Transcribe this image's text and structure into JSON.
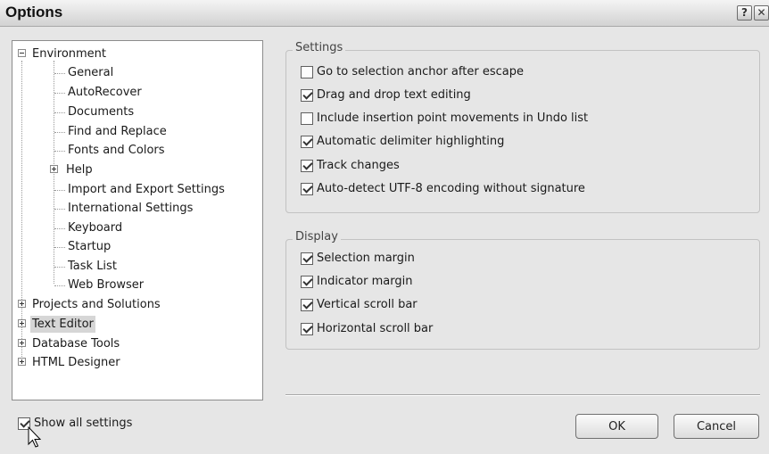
{
  "window": {
    "title": "Options",
    "help_glyph": "?",
    "close_glyph": "✕"
  },
  "tree": {
    "environment": "Environment",
    "env_children": [
      "General",
      "AutoRecover",
      "Documents",
      "Find and Replace",
      "Fonts and Colors",
      "Help",
      "Import and Export Settings",
      "International Settings",
      "Keyboard",
      "Startup",
      "Task List",
      "Web Browser"
    ],
    "projects": "Projects and Solutions",
    "text_editor": "Text Editor",
    "database_tools": "Database Tools",
    "html_designer": "HTML Designer",
    "selected": "Text Editor"
  },
  "settings_group": {
    "title": "Settings",
    "items": [
      {
        "label": "Go to selection anchor after escape",
        "checked": false
      },
      {
        "label": "Drag and drop text editing",
        "checked": true
      },
      {
        "label": "Include insertion point movements in Undo list",
        "checked": false
      },
      {
        "label": "Automatic delimiter highlighting",
        "checked": true
      },
      {
        "label": "Track changes",
        "checked": true
      },
      {
        "label": "Auto-detect UTF-8 encoding without signature",
        "checked": true
      }
    ]
  },
  "display_group": {
    "title": "Display",
    "items": [
      {
        "label": "Selection margin",
        "checked": true
      },
      {
        "label": "Indicator margin",
        "checked": true
      },
      {
        "label": "Vertical scroll bar",
        "checked": true
      },
      {
        "label": "Horizontal scroll bar",
        "checked": true
      }
    ]
  },
  "footer": {
    "show_all": {
      "label": "Show all settings",
      "checked": true
    },
    "ok_label": "OK",
    "cancel_label": "Cancel"
  },
  "colors": {
    "dialog_bg": "#e6e6e6",
    "selection_bg": "#d6d6d6",
    "border": "#8c8c8c"
  }
}
